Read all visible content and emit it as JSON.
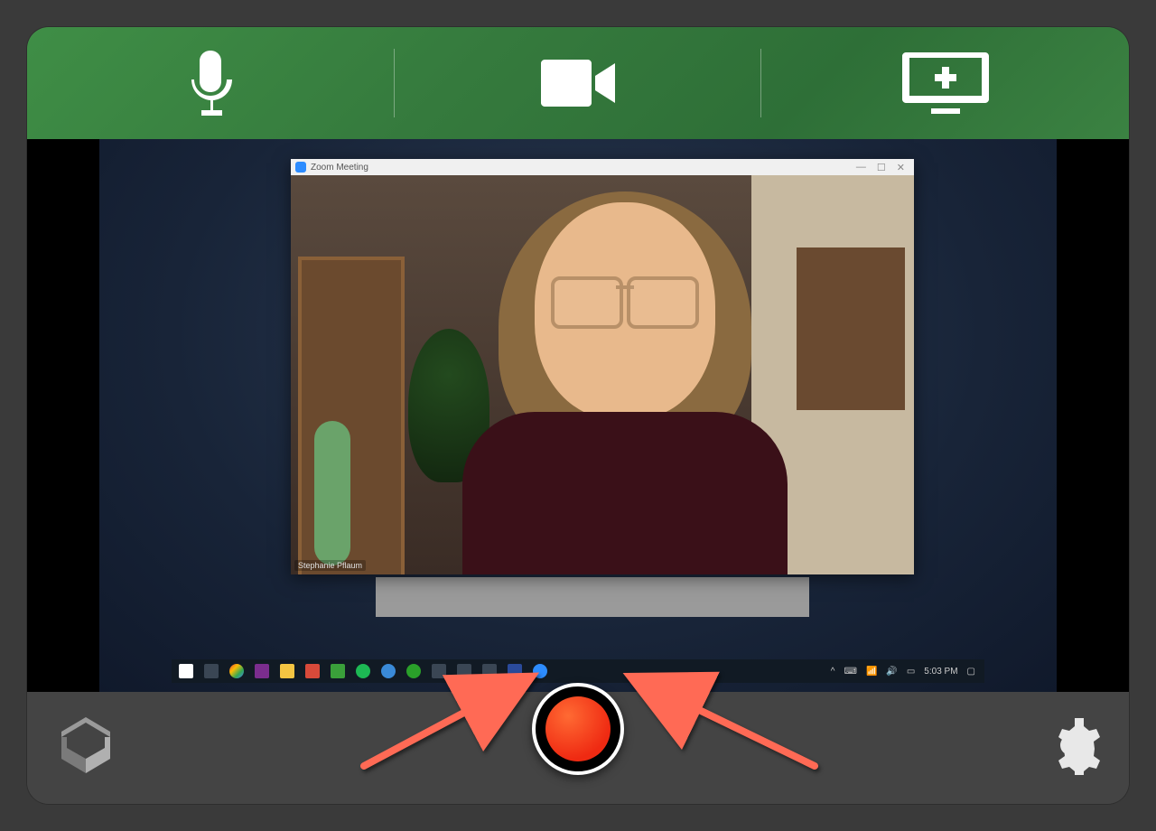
{
  "modes": {
    "audio_label": "Microphone",
    "video_label": "Camera",
    "screen_label": "Screen"
  },
  "captured_screen": {
    "zoom_window_title": "Zoom Meeting",
    "participant_name": "Stephanie Pflaum",
    "taskbar_time": "5:03 PM"
  },
  "footer": {
    "record_label": "Record",
    "settings_label": "Settings",
    "app_logo_label": "Panopto"
  },
  "annotations": {
    "left_arrow": "points-to-record-button",
    "right_arrow": "points-to-record-button"
  },
  "colors": {
    "header_green": "#3b8242",
    "record_red": "#ef2a12",
    "footer_gray": "#444444",
    "arrow_red": "#ff6a55"
  }
}
